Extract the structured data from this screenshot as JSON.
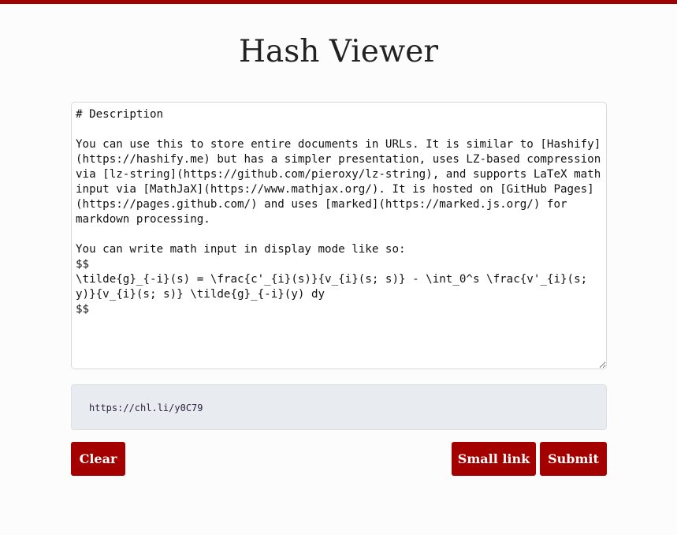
{
  "app": {
    "title": "Hash Viewer"
  },
  "editor": {
    "content": "# Description\n\nYou can use this to store entire documents in URLs. It is similar to [Hashify](https://hashify.me) but has a simpler presentation, uses LZ-based compression via [lz-string](https://github.com/pieroxy/lz-string), and supports LaTeX math input via [MathJaX](https://www.mathjax.org/). It is hosted on [GitHub Pages](https://pages.github.com/) and uses [marked](https://marked.js.org/) for markdown processing.\n\nYou can write math input in display mode like so:\n$$\n\\tilde{g}_{-i}(s) = \\frac{c'_{i}(s)}{v_{i}(s; s)} - \\int_0^s \\frac{v'_{i}(s; y)}{v_{i}(s; s)} \\tilde{g}_{-i}(y) dy\n$$"
  },
  "short_link": {
    "url": "https://chl.li/y0C79"
  },
  "buttons": {
    "clear": "Clear",
    "small_link": "Small link",
    "submit": "Submit"
  },
  "colors": {
    "accent": "#a50000",
    "link_box_bg": "#e8ebf0"
  }
}
